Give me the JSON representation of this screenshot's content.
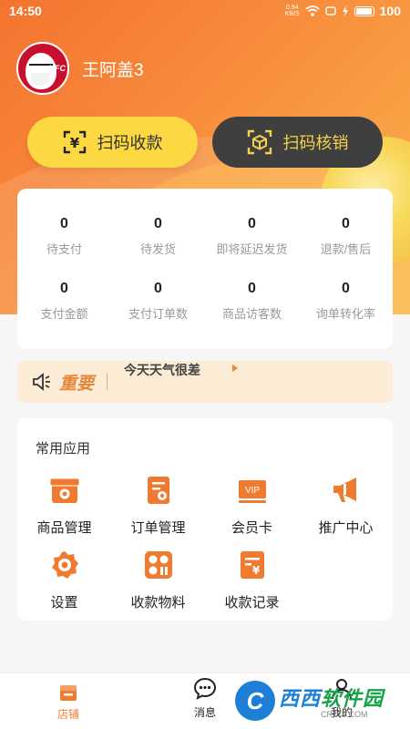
{
  "status_bar": {
    "time": "14:50",
    "net_speed": "0.94",
    "net_unit": "KB/S",
    "battery": "100"
  },
  "profile": {
    "avatar_text": "KFC",
    "username": "王阿盖3"
  },
  "actions": {
    "scan_pay": "扫码收款",
    "scan_verify": "扫码核销"
  },
  "stats": [
    {
      "value": "0",
      "label": "待支付"
    },
    {
      "value": "0",
      "label": "待发货"
    },
    {
      "value": "0",
      "label": "即将延迟发货"
    },
    {
      "value": "0",
      "label": "退款/售后"
    },
    {
      "value": "0",
      "label": "支付金额"
    },
    {
      "value": "0",
      "label": "支付订单数"
    },
    {
      "value": "0",
      "label": "商品访客数"
    },
    {
      "value": "0",
      "label": "询单转化率"
    }
  ],
  "notice": {
    "tag": "重要",
    "message": "今天天气很差"
  },
  "apps": {
    "title": "常用应用",
    "items": [
      {
        "label": "商品管理",
        "icon": "product-icon"
      },
      {
        "label": "订单管理",
        "icon": "order-icon"
      },
      {
        "label": "会员卡",
        "icon": "vip-card-icon",
        "icon_text": "VIP"
      },
      {
        "label": "推广中心",
        "icon": "megaphone-icon"
      },
      {
        "label": "设置",
        "icon": "gear-icon"
      },
      {
        "label": "收款物料",
        "icon": "qr-material-icon"
      },
      {
        "label": "收款记录",
        "icon": "receipt-icon",
        "icon_text": "¥"
      }
    ]
  },
  "tabbar": {
    "shop": "店铺",
    "messages": "消息",
    "mine": "我的"
  },
  "watermark": {
    "main_a": "西西",
    "main_b": "软件园",
    "sub": "CR173.COM"
  },
  "colors": {
    "accent": "#f07a30",
    "scan_button": "#fcd843",
    "verify_button": "#3f3f3f",
    "notice_bg": "#fcecd5"
  }
}
